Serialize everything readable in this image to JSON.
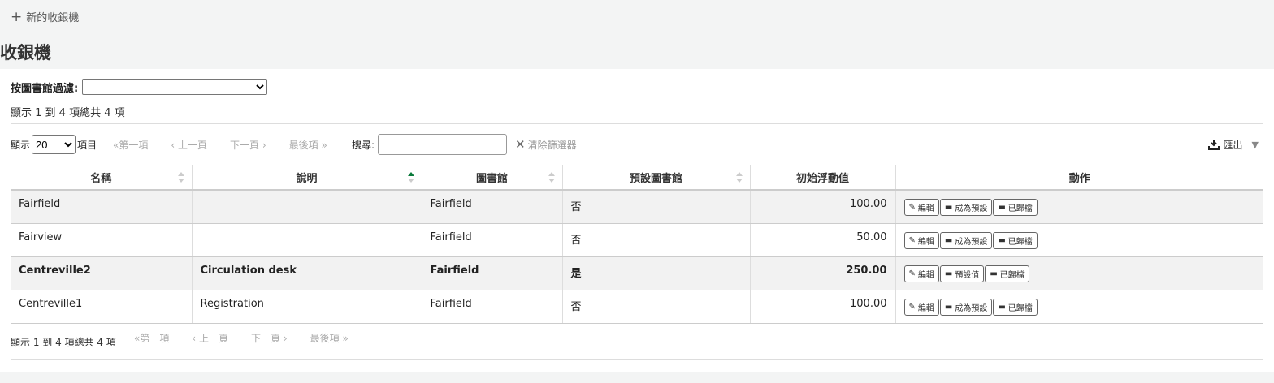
{
  "toolbar": {
    "new_register": "新的收銀機"
  },
  "page_title": "收銀機",
  "filter": {
    "label": "按圖書館過濾:"
  },
  "info_top": "顯示 1 到 4 項總共 4 項",
  "info_bottom": "顯示 1 到 4 項總共 4 項",
  "length": {
    "prefix": "顯示",
    "value": "20",
    "suffix": "項目"
  },
  "pager": {
    "first": "第一項",
    "prev": "上一頁",
    "next": "下一頁",
    "last": "最後項"
  },
  "search": {
    "label": "搜尋:",
    "clear": "清除篩選器"
  },
  "export": {
    "label": "匯出"
  },
  "columns": [
    "名稱",
    "說明",
    "圖書館",
    "預設圖書館",
    "初始浮動值",
    "動作"
  ],
  "rows": [
    {
      "name": "Fairfield",
      "description": "",
      "library": "Fairfield",
      "default": "否",
      "float": "100.00",
      "actions": [
        "編輯",
        "成為預設",
        "已歸檔"
      ]
    },
    {
      "name": "Fairview",
      "description": "",
      "library": "Fairfield",
      "default": "否",
      "float": "50.00",
      "actions": [
        "編輯",
        "成為預設",
        "已歸檔"
      ]
    },
    {
      "name": "Centreville2",
      "description": "Circulation desk",
      "library": "Fairfield",
      "default": "是",
      "float": "250.00",
      "actions": [
        "編輯",
        "預設值",
        "已歸檔"
      ]
    },
    {
      "name": "Centreville1",
      "description": "Registration",
      "library": "Fairfield",
      "default": "否",
      "float": "100.00",
      "actions": [
        "編輯",
        "成為預設",
        "已歸檔"
      ]
    }
  ],
  "colors": {
    "sort_active": "#0a7a3b",
    "stripe": "#f2f2f2"
  },
  "icons": {
    "edit": "pencil-icon",
    "default": "archive-box-icon",
    "archive": "archive-icon",
    "export": "download-icon"
  }
}
